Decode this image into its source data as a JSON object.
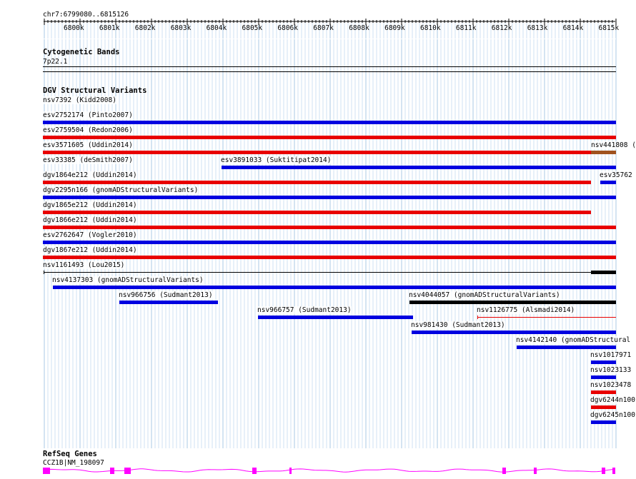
{
  "ruler": {
    "locus": "chr7:6799080..6815126",
    "ticks": [
      "6800k",
      "6801k",
      "6802k",
      "6803k",
      "6804k",
      "6805k",
      "6806k",
      "6807k",
      "6808k",
      "6809k",
      "6810k",
      "6811k",
      "6812k",
      "6813k",
      "6814k",
      "6815k"
    ]
  },
  "cytoband": {
    "title": "Cytogenetic Bands",
    "band": "7p22.1"
  },
  "dgv": {
    "title": "DGV Structural Variants",
    "colors": {
      "blue": "#0000e0",
      "red": "#e80000",
      "black": "#000000",
      "brown": "#a0521e"
    },
    "features": [
      {
        "label": "nsv7392 (Kidd2008)",
        "color": "none"
      },
      {
        "label": "esv2752174 (Pinto2007)",
        "color": "blue"
      },
      {
        "label": "esv2759504 (Redon2006)",
        "color": "red"
      },
      {
        "label": "esv3571605 (Uddin2014)",
        "color": "red"
      },
      {
        "label": "nsv441808 (",
        "color": "brown"
      },
      {
        "label": "esv33385 (deSmith2007)",
        "color": "blue"
      },
      {
        "label": "esv3891033 (Suktitipat2014)",
        "color": "blue"
      },
      {
        "label": "dgv1864e212 (Uddin2014)",
        "color": "red"
      },
      {
        "label": "esv35762",
        "color": "blue"
      },
      {
        "label": "dgv2295n166 (gnomADStructuralVariants)",
        "color": "blue"
      },
      {
        "label": "dgv1865e212 (Uddin2014)",
        "color": "red"
      },
      {
        "label": "dgv1866e212 (Uddin2014)",
        "color": "red"
      },
      {
        "label": "esv2762647 (Vogler2010)",
        "color": "blue"
      },
      {
        "label": "dgv1867e212 (Uddin2014)",
        "color": "red"
      },
      {
        "label": "nsv1161493 (Lou2015)",
        "color": "black"
      },
      {
        "label": "nsv4137303 (gnomADStructuralVariants)",
        "color": "blue"
      },
      {
        "label": "nsv966756 (Sudmant2013)",
        "color": "blue"
      },
      {
        "label": "nsv4044057 (gnomADStructuralVariants)",
        "color": "black"
      },
      {
        "label": "nsv966757 (Sudmant2013)",
        "color": "blue"
      },
      {
        "label": "nsv1126775 (Alsmadi2014)",
        "color": "red"
      },
      {
        "label": "nsv981430 (Sudmant2013)",
        "color": "blue"
      },
      {
        "label": "nsv4142140 (gnomADStructural",
        "color": "blue"
      },
      {
        "label": "nsv1017971",
        "color": "blue"
      },
      {
        "label": "nsv1023133",
        "color": "blue"
      },
      {
        "label": "nsv1023478",
        "color": "red"
      },
      {
        "label": "dgv6244n100",
        "color": "red"
      },
      {
        "label": "dgv6245n100",
        "color": "blue"
      }
    ]
  },
  "refseq": {
    "title": "RefSeq Genes",
    "gene": "CCZ1B|NM_198097",
    "color": "#ff00ff"
  }
}
